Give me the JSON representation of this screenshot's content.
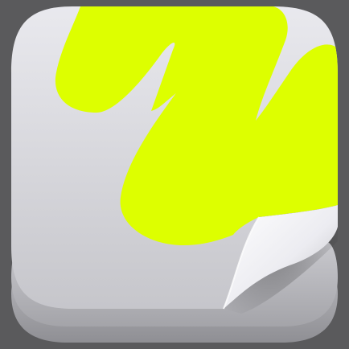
{
  "app_icon": {
    "icon_name": "markup-scribble-icon",
    "colors": {
      "background": "#5a5a5c",
      "stack_dark": "#9d9da2",
      "stack_mid": "#b4b4b9",
      "tile_light": "#e9e9ee",
      "tile_shadow": "#c4c4c9",
      "stroke_accent": "#ddff00",
      "curl_light": "#f3f3f7",
      "curl_shade": "#a9a9ae"
    }
  }
}
